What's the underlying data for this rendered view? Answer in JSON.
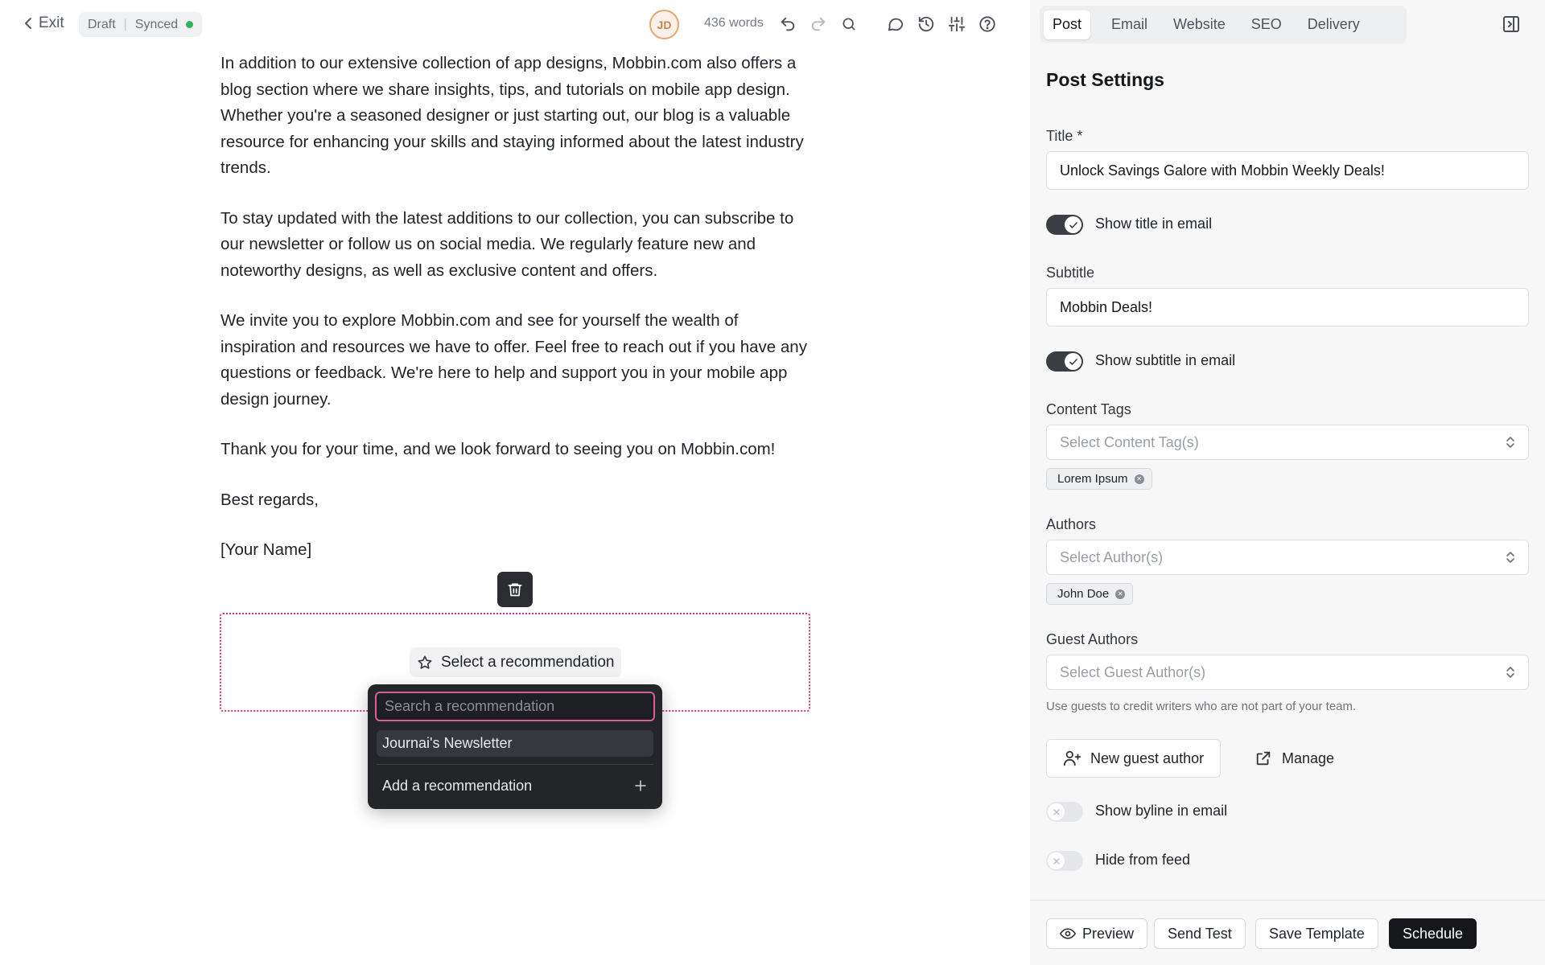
{
  "topbar": {
    "exit_label": "Exit",
    "status_draft": "Draft",
    "status_synced": "Synced",
    "avatar_initials": "JD",
    "word_count": "436 words"
  },
  "editor": {
    "paragraphs": [
      "In addition to our extensive collection of app designs, Mobbin.com also offers a blog section where we share insights, tips, and tutorials on mobile app design. Whether you're a seasoned designer or just starting out, our blog is a valuable resource for enhancing your skills and staying informed about the latest industry trends.",
      "To stay updated with the latest additions to our collection, you can subscribe to our newsletter or follow us on social media. We regularly feature new and noteworthy designs, as well as exclusive content and offers.",
      "We invite you to explore Mobbin.com and see for yourself the wealth of inspiration and resources we have to offer. Feel free to reach out if you have any questions or feedback. We're here to help and support you in your mobile app design journey.",
      "Thank you for your time, and we look forward to seeing you on Mobbin.com!",
      "Best regards,",
      "[Your Name]"
    ],
    "recommendation": {
      "select_label": "Select a recommendation",
      "search_placeholder": "Search a recommendation",
      "items": [
        "Journai's Newsletter"
      ],
      "add_label": "Add a recommendation"
    }
  },
  "panel": {
    "tabs": [
      "Post",
      "Email",
      "Website",
      "SEO",
      "Delivery"
    ],
    "active_tab": "Post",
    "title": "Post Settings",
    "title_label": "Title *",
    "title_value": "Unlock Savings Galore with Mobbin Weekly Deals!",
    "show_title_label": "Show title in email",
    "show_title_on": true,
    "subtitle_label": "Subtitle",
    "subtitle_value": "Mobbin Deals!",
    "show_subtitle_label": "Show subtitle in email",
    "show_subtitle_on": true,
    "content_tags_label": "Content Tags",
    "content_tags_placeholder": "Select Content Tag(s)",
    "content_tags": [
      "Lorem Ipsum"
    ],
    "authors_label": "Authors",
    "authors_placeholder": "Select Author(s)",
    "authors": [
      "John Doe"
    ],
    "guest_authors_label": "Guest Authors",
    "guest_authors_placeholder": "Select Guest Author(s)",
    "guest_help": "Use guests to credit writers who are not part of your team.",
    "new_guest_label": "New guest author",
    "manage_label": "Manage",
    "show_byline_label": "Show byline in email",
    "show_byline_on": false,
    "hide_feed_label": "Hide from feed",
    "hide_feed_on": false
  },
  "footer": {
    "preview": "Preview",
    "send_test": "Send Test",
    "save_template": "Save Template",
    "schedule": "Schedule"
  },
  "colors": {
    "accent_pink": "#d9347d",
    "synced_green": "#33b357",
    "primary_dark": "#15171a"
  }
}
